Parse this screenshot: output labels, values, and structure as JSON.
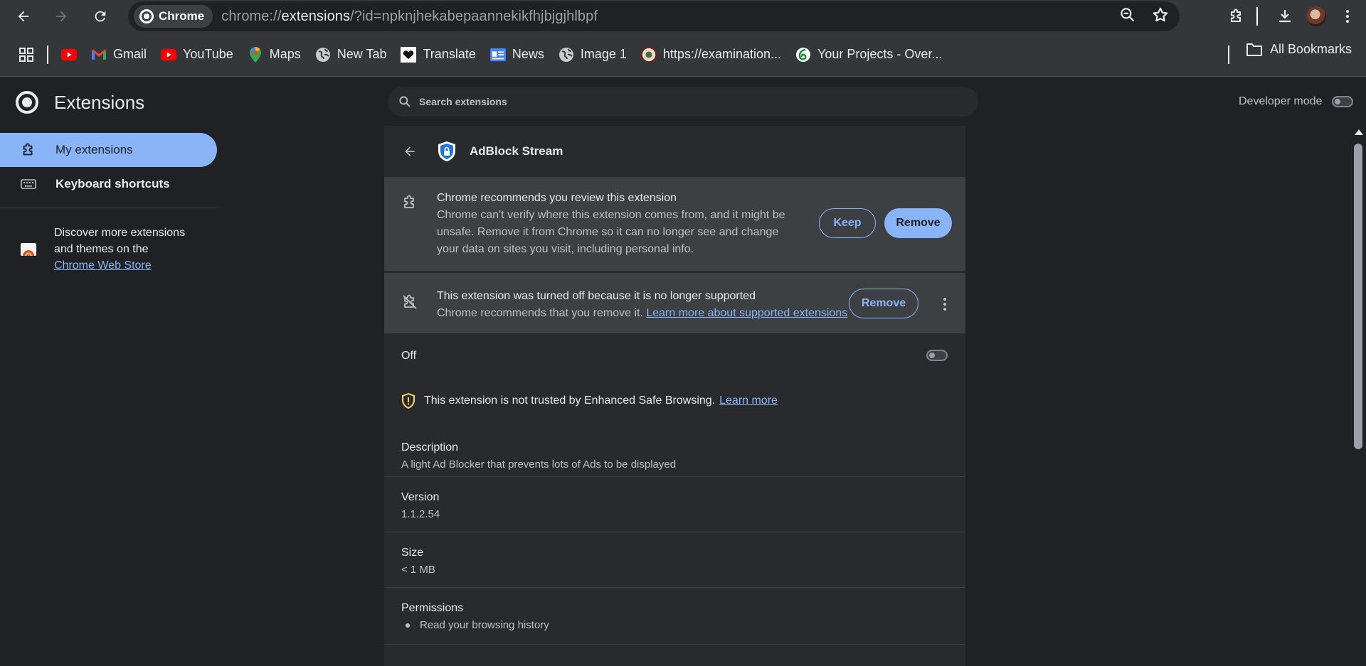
{
  "toolbar": {
    "chip_label": "Chrome",
    "url_prefix": "chrome://",
    "url_main": "extensions",
    "url_rest": "/?id=npknjhekabepaannekikfhjbjgjhlbpf"
  },
  "bookmarks": {
    "items": [
      {
        "label": "",
        "icon": "youtube-icon"
      },
      {
        "label": "Gmail",
        "icon": "gmail-icon"
      },
      {
        "label": "YouTube",
        "icon": "youtube-icon"
      },
      {
        "label": "Maps",
        "icon": "maps-pin-icon"
      },
      {
        "label": "New Tab",
        "icon": "globe-icon"
      },
      {
        "label": "Translate",
        "icon": "heart-icon"
      },
      {
        "label": "News",
        "icon": "news-icon"
      },
      {
        "label": "Image 1",
        "icon": "globe-icon"
      },
      {
        "label": "https://examination...",
        "icon": "seal-icon"
      },
      {
        "label": "Your Projects - Over...",
        "icon": "overleaf-icon"
      }
    ],
    "all_label": "All Bookmarks"
  },
  "sidebar": {
    "title": "Extensions",
    "items": [
      {
        "label": "My extensions",
        "icon": "puzzle-icon",
        "active": true
      },
      {
        "label": "Keyboard shortcuts",
        "icon": "keyboard-icon",
        "active": false
      }
    ],
    "discover_text": "Discover more extensions and themes on the",
    "discover_link": "Chrome Web Store"
  },
  "search": {
    "placeholder": "Search extensions"
  },
  "developer_mode": {
    "label": "Developer mode",
    "enabled": false
  },
  "extension": {
    "name": "AdBlock Stream",
    "review_warning": {
      "title": "Chrome recommends you review this extension",
      "body": "Chrome can't verify where this extension comes from, and it might be unsafe. Remove it from Chrome so it can no longer see and change your data on sites you visit, including personal info.",
      "keep_label": "Keep",
      "remove_label": "Remove"
    },
    "unsupported_warning": {
      "title": "This extension was turned off because it is no longer supported",
      "body": "Chrome recommends that you remove it.",
      "link": "Learn more about supported extensions",
      "remove_label": "Remove"
    },
    "status_label": "Off",
    "enabled": false,
    "trust_notice": "This extension is not trusted by Enhanced Safe Browsing.",
    "trust_link": "Learn more",
    "description_label": "Description",
    "description": "A light Ad Blocker that prevents lots of Ads to be displayed",
    "version_label": "Version",
    "version": "1.1.2.54",
    "size_label": "Size",
    "size": "< 1 MB",
    "permissions_label": "Permissions",
    "permissions": [
      "Read your browsing history"
    ]
  },
  "colors": {
    "accent": "#8ab4f8",
    "background": "#202124",
    "card": "#292a2d",
    "warning_bg": "#3c4043",
    "caution_yellow": "#fdd663"
  }
}
